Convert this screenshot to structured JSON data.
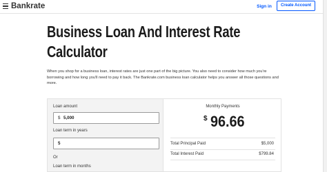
{
  "header": {
    "brand": "Bankrate",
    "sign_in": "Sign in",
    "create_account": "Create Account"
  },
  "page": {
    "title_line1": "Business Loan And Interest Rate",
    "title_line2": "Calculator",
    "intro": "When you shop for a business loan, interest rates are just one part of the big picture. You also need to consider how much you're borrowing and how long you'll need to pay it back. The Bankrate.com business loan calculator helps you answer all those questions and more."
  },
  "calculator": {
    "loan_amount_label": "Loan amount",
    "loan_amount_prefix": "$",
    "loan_amount_value": "5,000",
    "loan_term_years_label": "Loan term in years",
    "loan_term_years_value": "5",
    "or_label": "Or",
    "loan_term_months_label": "Loan term in months"
  },
  "results": {
    "monthly_label": "Monthly Payments",
    "currency": "$",
    "monthly_value": "96.66",
    "principal_label": "Total Principal Paid",
    "principal_value": "$5,000",
    "interest_label": "Total Interest Paid",
    "interest_value": "$799.84"
  }
}
